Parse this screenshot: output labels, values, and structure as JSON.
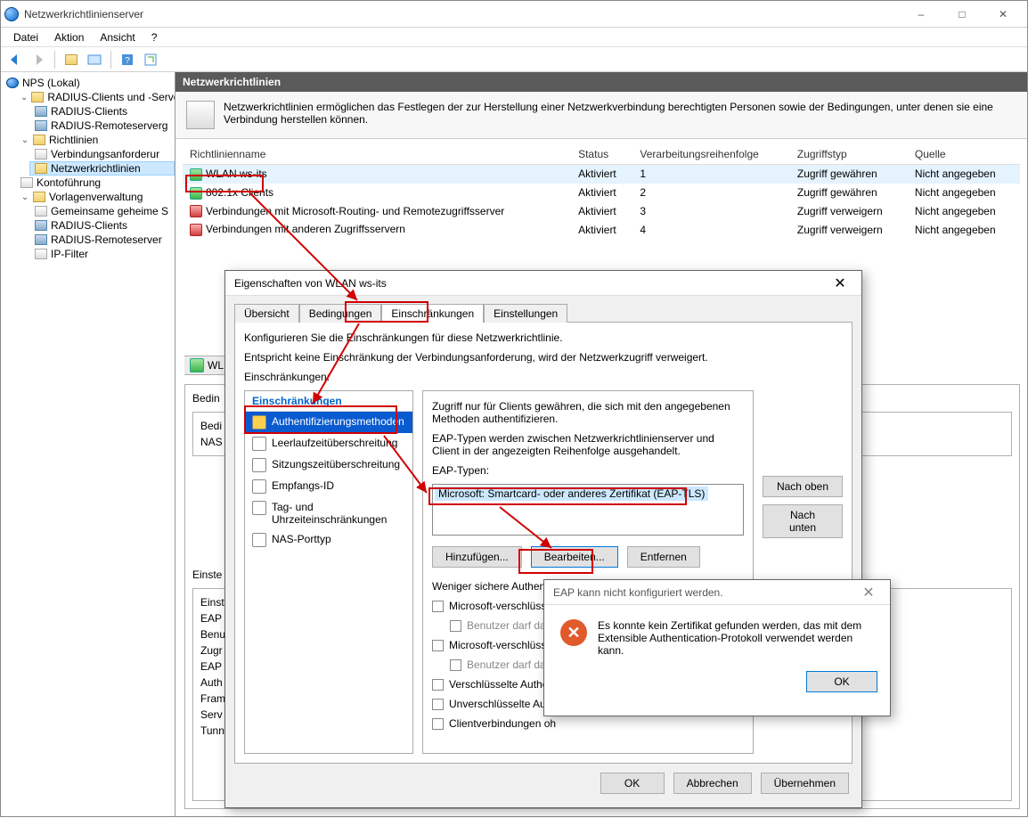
{
  "window": {
    "title": "Netzwerkrichtlinienserver"
  },
  "menubar": {
    "file": "Datei",
    "action": "Aktion",
    "view": "Ansicht",
    "help": "?"
  },
  "tree": {
    "root": "NPS (Lokal)",
    "radius_clients_servers": "RADIUS-Clients und -Serve",
    "radius_clients": "RADIUS-Clients",
    "radius_remote": "RADIUS-Remoteserverg",
    "policies": "Richtlinien",
    "conn_req": "Verbindungsanforderur",
    "net_policies": "Netzwerkrichtlinien",
    "accounting": "Kontoführung",
    "templates": "Vorlagenverwaltung",
    "shared_secrets": "Gemeinsame geheime S",
    "radius_clients2": "RADIUS-Clients",
    "radius_remote2": "RADIUS-Remoteserver",
    "ip_filter": "IP-Filter"
  },
  "content": {
    "header": "Netzwerkrichtlinien",
    "banner": "Netzwerkrichtlinien ermöglichen das Festlegen der zur Herstellung einer Netzwerkverbindung berechtigten Personen sowie der Bedingungen, unter denen sie eine Verbindung herstellen können.",
    "columns": {
      "name": "Richtlinienname",
      "status": "Status",
      "order": "Verarbeitungsreihenfolge",
      "access": "Zugriffstyp",
      "source": "Quelle"
    },
    "rows": [
      {
        "name": "WLAN ws-its",
        "status": "Aktiviert",
        "order": "1",
        "access": "Zugriff gewähren",
        "source": "Nicht angegeben",
        "kind": "ok"
      },
      {
        "name": "802.1x Clients",
        "status": "Aktiviert",
        "order": "2",
        "access": "Zugriff gewähren",
        "source": "Nicht angegeben",
        "kind": "ok"
      },
      {
        "name": "Verbindungen mit Microsoft-Routing- und Remotezugriffsserver",
        "status": "Aktiviert",
        "order": "3",
        "access": "Zugriff verweigern",
        "source": "Nicht angegeben",
        "kind": "no"
      },
      {
        "name": "Verbindungen mit anderen Zugriffsservern",
        "status": "Aktiviert",
        "order": "4",
        "access": "Zugriff verweigern",
        "source": "Nicht angegeben",
        "kind": "no"
      }
    ]
  },
  "wl_frag": "WL",
  "lower": {
    "bedin_hdr": "Bedin",
    "bedi": "Bedi",
    "nas": "NAS",
    "einste_hdr": "Einste",
    "items": [
      "Einst",
      "EAP",
      "Benu",
      "Zugr",
      "EAP",
      "Auth",
      "Fram",
      "Serv",
      "Tunn"
    ]
  },
  "props": {
    "title": "Eigenschaften von WLAN ws-its",
    "tabs": {
      "overview": "Übersicht",
      "conditions": "Bedingungen",
      "constraints": "Einschränkungen",
      "settings": "Einstellungen"
    },
    "intro1": "Konfigurieren Sie die Einschränkungen für diese Netzwerkrichtlinie.",
    "intro2": "Entspricht keine Einschränkung der Verbindungsanforderung, wird der Netzwerkzugriff verweigert.",
    "list_label": "Einschränkungen:",
    "list_header": "Einschränkungen",
    "items": {
      "auth": "Authentifizierungsmethoden",
      "idle": "Leerlaufzeitüberschreitung",
      "session": "Sitzungszeitüberschreitung",
      "called": "Empfangs-ID",
      "daytime": "Tag- und Uhrzeiteinschränkungen",
      "nasport": "NAS-Porttyp"
    },
    "detail": {
      "text1": "Zugriff nur für Clients gewähren, die sich mit den angegebenen Methoden authentifizieren.",
      "text2": "EAP-Typen werden zwischen Netzwerkrichtlinienserver und Client in der angezeigten Reihenfolge ausgehandelt.",
      "eap_label": "EAP-Typen:",
      "eap_selected": "Microsoft: Smartcard- oder anderes Zertifikat (EAP-TLS)",
      "up": "Nach oben",
      "down": "Nach unten",
      "add": "Hinzufügen...",
      "edit": "Bearbeiten...",
      "remove": "Entfernen",
      "less_secure": "Weniger sichere Authenti",
      "mschap2": "Microsoft-verschlüssel",
      "mschap2_pw": "Benutzer darf das I",
      "mschap1": "Microsoft-verschlüssel",
      "mschap1_pw": "Benutzer darf das I",
      "chap": "Verschlüsselte Authen",
      "pap": "Unverschlüsselte Auth",
      "unauth": "Clientverbindungen oh"
    },
    "ok": "OK",
    "cancel": "Abbrechen",
    "apply": "Übernehmen"
  },
  "err": {
    "title": "EAP kann nicht konfiguriert werden.",
    "body": "Es konnte kein Zertifikat gefunden werden, das mit dem Extensible Authentication-Protokoll verwendet werden kann.",
    "ok": "OK"
  }
}
